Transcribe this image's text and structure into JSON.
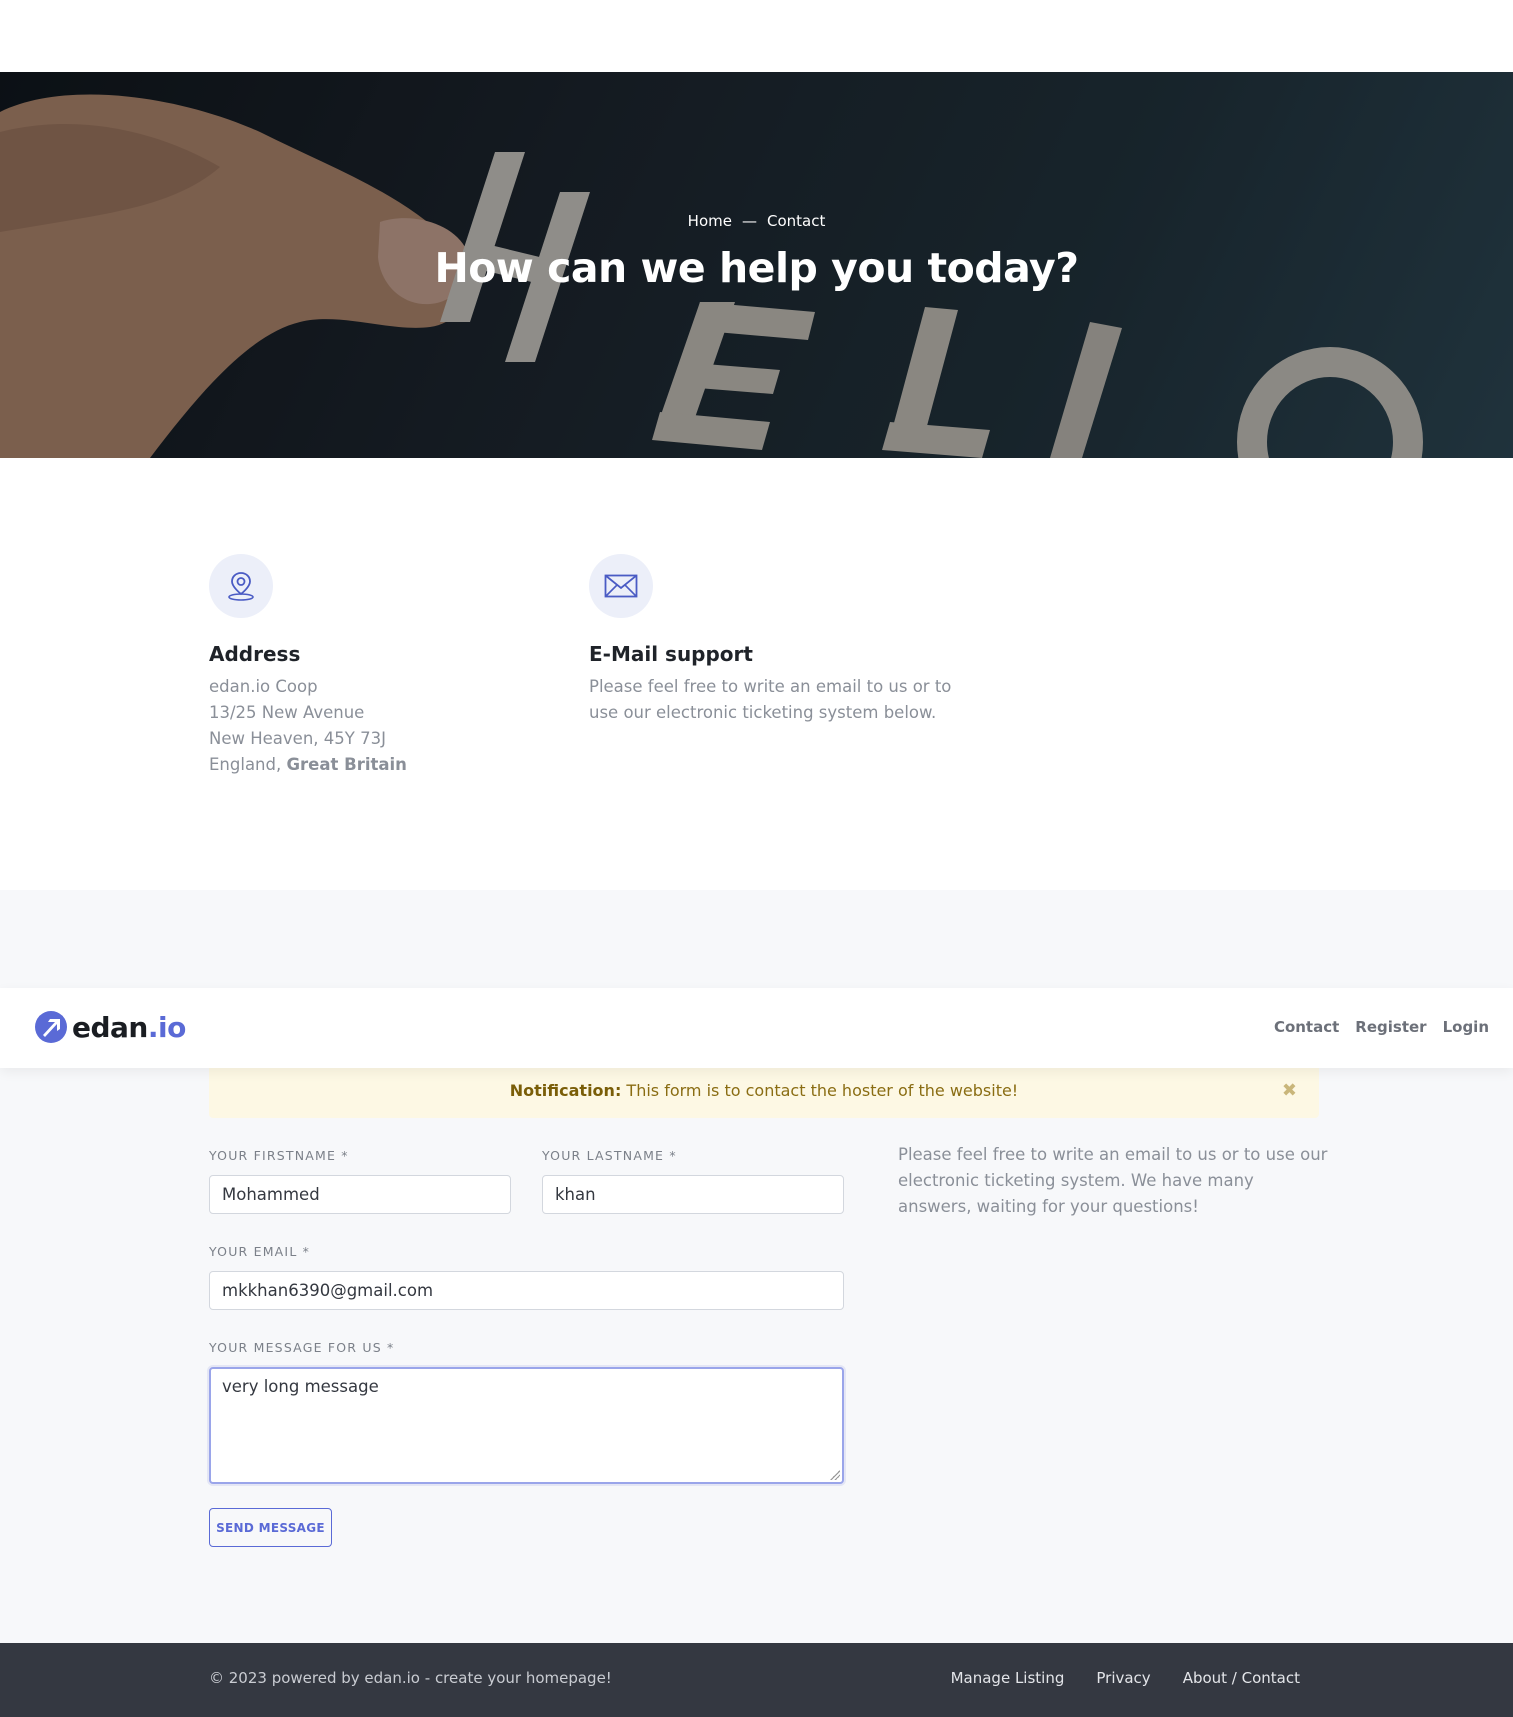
{
  "hero": {
    "breadcrumb_home": "Home",
    "breadcrumb_sep": "—",
    "breadcrumb_current": "Contact",
    "title": "How can we help you today?"
  },
  "address": {
    "icon": "map-pin-icon",
    "title": "Address",
    "line1": "edan.io Coop",
    "line2": "13/25 New Avenue",
    "line3": "New Heaven, 45Y 73J",
    "line4_prefix": "England, ",
    "line4_bold": "Great Britain"
  },
  "email_support": {
    "icon": "envelope-icon",
    "title": "E-Mail support",
    "text_line1": "Please feel free to write an email to us or to",
    "text_line2": "use our electronic ticketing system below."
  },
  "navbar": {
    "logo_main": "edan",
    "logo_suffix": ".io",
    "links": [
      "Contact",
      "Register",
      "Login"
    ]
  },
  "notification": {
    "label": "Notification:",
    "text": " This form is to contact the hoster of the website!",
    "close": "✖"
  },
  "form": {
    "firstname_label": "YOUR FIRSTNAME *",
    "firstname_value": "Mohammed",
    "lastname_label": "YOUR LASTNAME *",
    "lastname_value": "khan",
    "email_label": "YOUR EMAIL *",
    "email_value": "mkkhan6390@gmail.com",
    "message_label": "YOUR MESSAGE FOR US *",
    "message_value": "very long message",
    "submit_label": "SEND MESSAGE"
  },
  "side_text": "Please feel free to write an email to us or to use our electronic ticketing system. We have many answers, waiting for your questions!",
  "footer": {
    "copyright": "© 2023 powered by edan.io - create your homepage!",
    "links": [
      "Manage Listing",
      "Privacy",
      "About / Contact"
    ]
  },
  "colors": {
    "accent": "#5a6ad6",
    "footer_bg": "#343841",
    "notice_bg": "#fdf8e4"
  }
}
